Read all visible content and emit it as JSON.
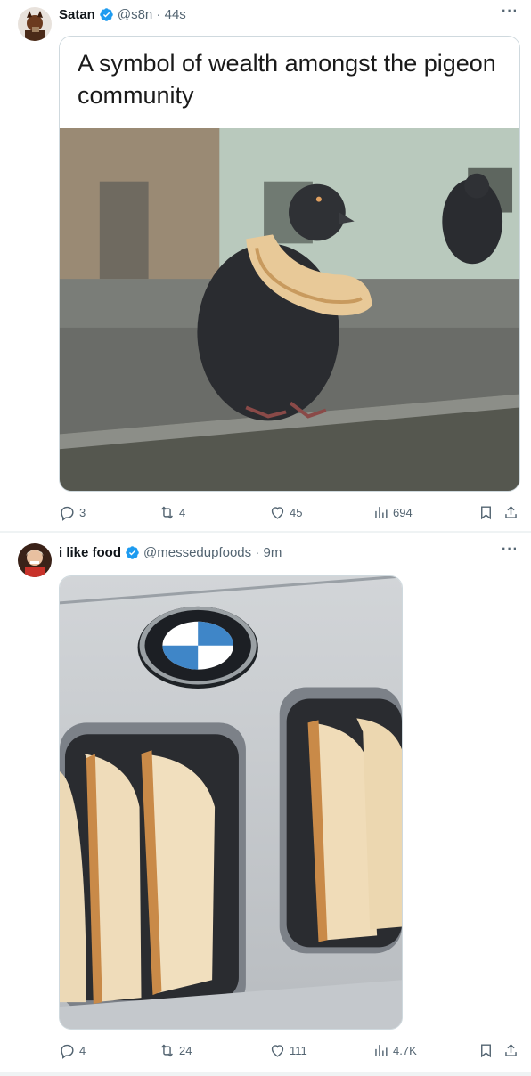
{
  "posts": [
    {
      "author_name": "Satan",
      "handle_time": "@s8n · 44s",
      "more_label": "···",
      "caption": "A symbol of wealth amongst the pigeon community",
      "stats": {
        "replies": "3",
        "reposts": "4",
        "likes": "45",
        "views": "694"
      }
    },
    {
      "author_name": "i like food",
      "handle_time": "@messedupfoods · 9m",
      "more_label": "···",
      "stats": {
        "replies": "4",
        "reposts": "24",
        "likes": "111",
        "views": "4.7K"
      }
    }
  ],
  "icons": {
    "verified": "verified-badge-icon",
    "reply": "reply-icon",
    "repost": "repost-icon",
    "like": "heart-icon",
    "views": "views-icon",
    "bookmark": "bookmark-icon",
    "share": "share-icon"
  },
  "colors": {
    "verified_blue": "#1d9bf0",
    "muted_text": "#536471",
    "primary_text": "#0f1419",
    "separator": "#eff3f4"
  }
}
